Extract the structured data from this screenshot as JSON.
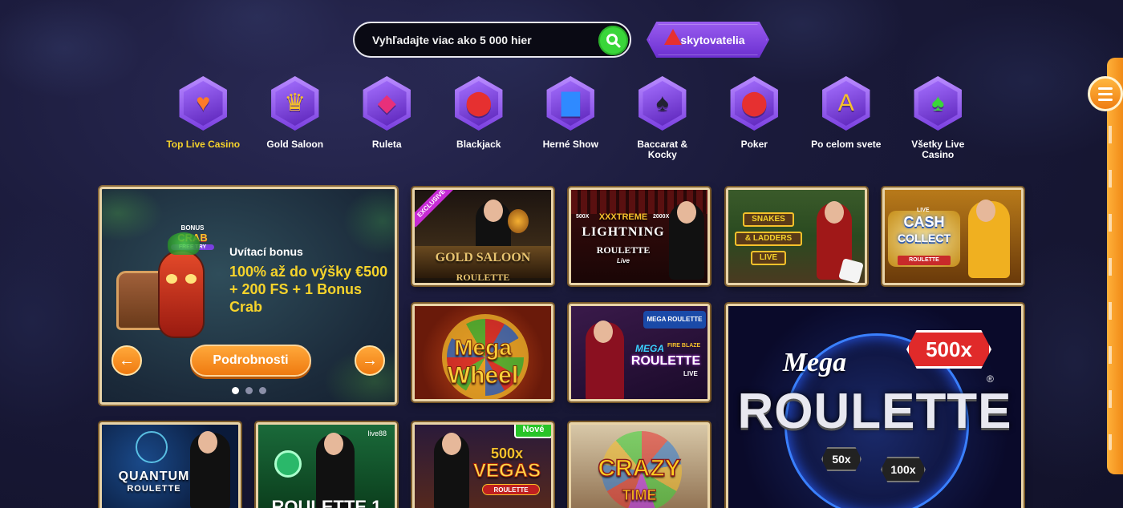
{
  "search": {
    "placeholder": "Vyhľadajte viac ako 5 000 hier"
  },
  "providers_button": {
    "label": "skytovatelia"
  },
  "categories": [
    {
      "label": "Top Live Casino",
      "icon": "heart-icon",
      "glyph": "♥",
      "color": "#ff7a2a",
      "active": true
    },
    {
      "label": "Gold Saloon",
      "icon": "crown-icon",
      "glyph": "♛",
      "color": "#f6c12b",
      "active": false
    },
    {
      "label": "Ruleta",
      "icon": "diamond-icon",
      "glyph": "◆",
      "color": "#e8307a",
      "active": false
    },
    {
      "label": "Blackjack",
      "icon": "poker-chip-icon",
      "glyph": "⬤",
      "color": "#e63030",
      "active": false
    },
    {
      "label": "Herné Show",
      "icon": "top-hat-icon",
      "glyph": "▇",
      "color": "#2f8aff",
      "active": false
    },
    {
      "label": "Baccarat & Kocky",
      "icon": "spade-card-icon",
      "glyph": "♠",
      "color": "#222233",
      "active": false
    },
    {
      "label": "Poker",
      "icon": "poker-chip-icon",
      "glyph": "⬤",
      "color": "#e63030",
      "active": false
    },
    {
      "label": "Po celom svete",
      "icon": "language-icon",
      "glyph": "A",
      "color": "#f6c12b",
      "active": false
    },
    {
      "label": "Všetky Live Casino",
      "icon": "club-icon",
      "glyph": "♠",
      "color": "#3ad63a",
      "active": false
    }
  ],
  "promo": {
    "logo_top": "BONUS",
    "logo_main": "CRAB",
    "logo_sub": "FREE TRY",
    "small_title": "Uvítací bonus",
    "headline": "100% až do výšky €500 + 200 FS + 1 Bonus Crab",
    "cta": "Podrobnosti",
    "slides": 3,
    "active_slide": 1
  },
  "games": {
    "gold_saloon": {
      "line1": "GOLD SALOON",
      "line2": "ROULETTE",
      "badge": "EXCLUSIVE"
    },
    "lightning": {
      "line0": "XXXTREME",
      "line1": "LIGHTNING",
      "line2": "ROULETTE",
      "tag": "Live",
      "mult_left": "500X",
      "mult_right": "2000X"
    },
    "snakes": {
      "line1": "SNAKES",
      "line2": "& LADDERS",
      "line3": "LIVE"
    },
    "cash_collect": {
      "line0": "LIVE",
      "line1": "CASH",
      "line2": "COLLECT",
      "line3": "ROULETTE"
    },
    "mega_wheel": {
      "line1": "Mega",
      "line2": "Wheel"
    },
    "mega_fire": {
      "line1": "MEGA",
      "line2": "FIRE BLAZE",
      "line3": "ROULETTE",
      "line4": "LIVE",
      "top": "MEGA ROULETTE"
    },
    "mega_roulette": {
      "line1": "Mega",
      "line2": "ROULETTE",
      "mult_main": "500x",
      "mult_a": "50x",
      "mult_b": "100x",
      "reg": "®"
    },
    "quantum": {
      "line1": "QUANTUM",
      "line2": "ROULETTE"
    },
    "roulette1": {
      "line1": "ROULETTE 1",
      "provider": "live88"
    },
    "vegas": {
      "line1": "500x",
      "line2": "VEGAS",
      "line3": "ROULETTE",
      "badge": "Nové"
    },
    "crazy_time": {
      "line1": "CRAZY",
      "line2": "TIME"
    }
  }
}
